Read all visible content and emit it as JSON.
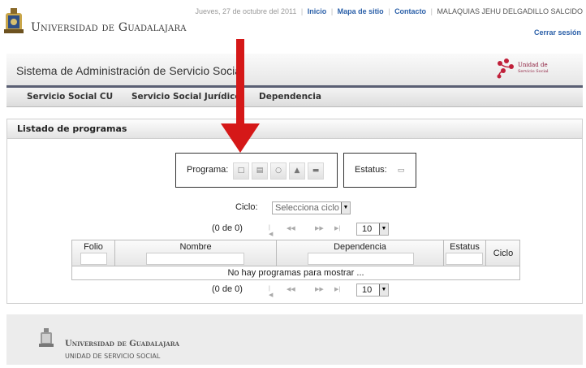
{
  "header": {
    "university": "Universidad de Guadalajara",
    "date": "Jueves, 27 de octubre del 2011",
    "links": [
      "Inicio",
      "Mapa de sitio",
      "Contacto"
    ],
    "user": "MALAQUIAS JEHU DELGADILLO SALCIDO",
    "logout": "Cerrar sesión"
  },
  "system": {
    "title": "Sistema de Administración de Servicio Social",
    "logo_line1": "Unidad de",
    "logo_line2": "Servicio Social"
  },
  "menu": [
    "Servicio Social CU",
    "Servicio Social Jurídico",
    "Dependencia"
  ],
  "panel": {
    "title": "Listado de programas",
    "programa_label": "Programa:",
    "programa_icons": [
      "new-icon",
      "edit-icon",
      "view-icon",
      "delete-icon",
      "print-icon"
    ],
    "estatus_label": "Estatus:",
    "estatus_icon": "status-icon",
    "ciclo_label": "Ciclo:",
    "ciclo_value": "Selecciona ciclo",
    "count": "(0 de 0)",
    "page_size": "10",
    "columns": [
      "Folio",
      "Nombre",
      "Dependencia",
      "Estatus",
      "Ciclo"
    ],
    "empty": "No hay programas para mostrar ..."
  },
  "footer": {
    "university": "Universidad de Guadalajara",
    "unit": "UNIDAD DE SERVICIO SOCIAL"
  },
  "colors": {
    "link": "#2a5fa8",
    "arrow": "#d51818",
    "band_border": "#5a5f73",
    "logo": "#8c1c3c"
  }
}
